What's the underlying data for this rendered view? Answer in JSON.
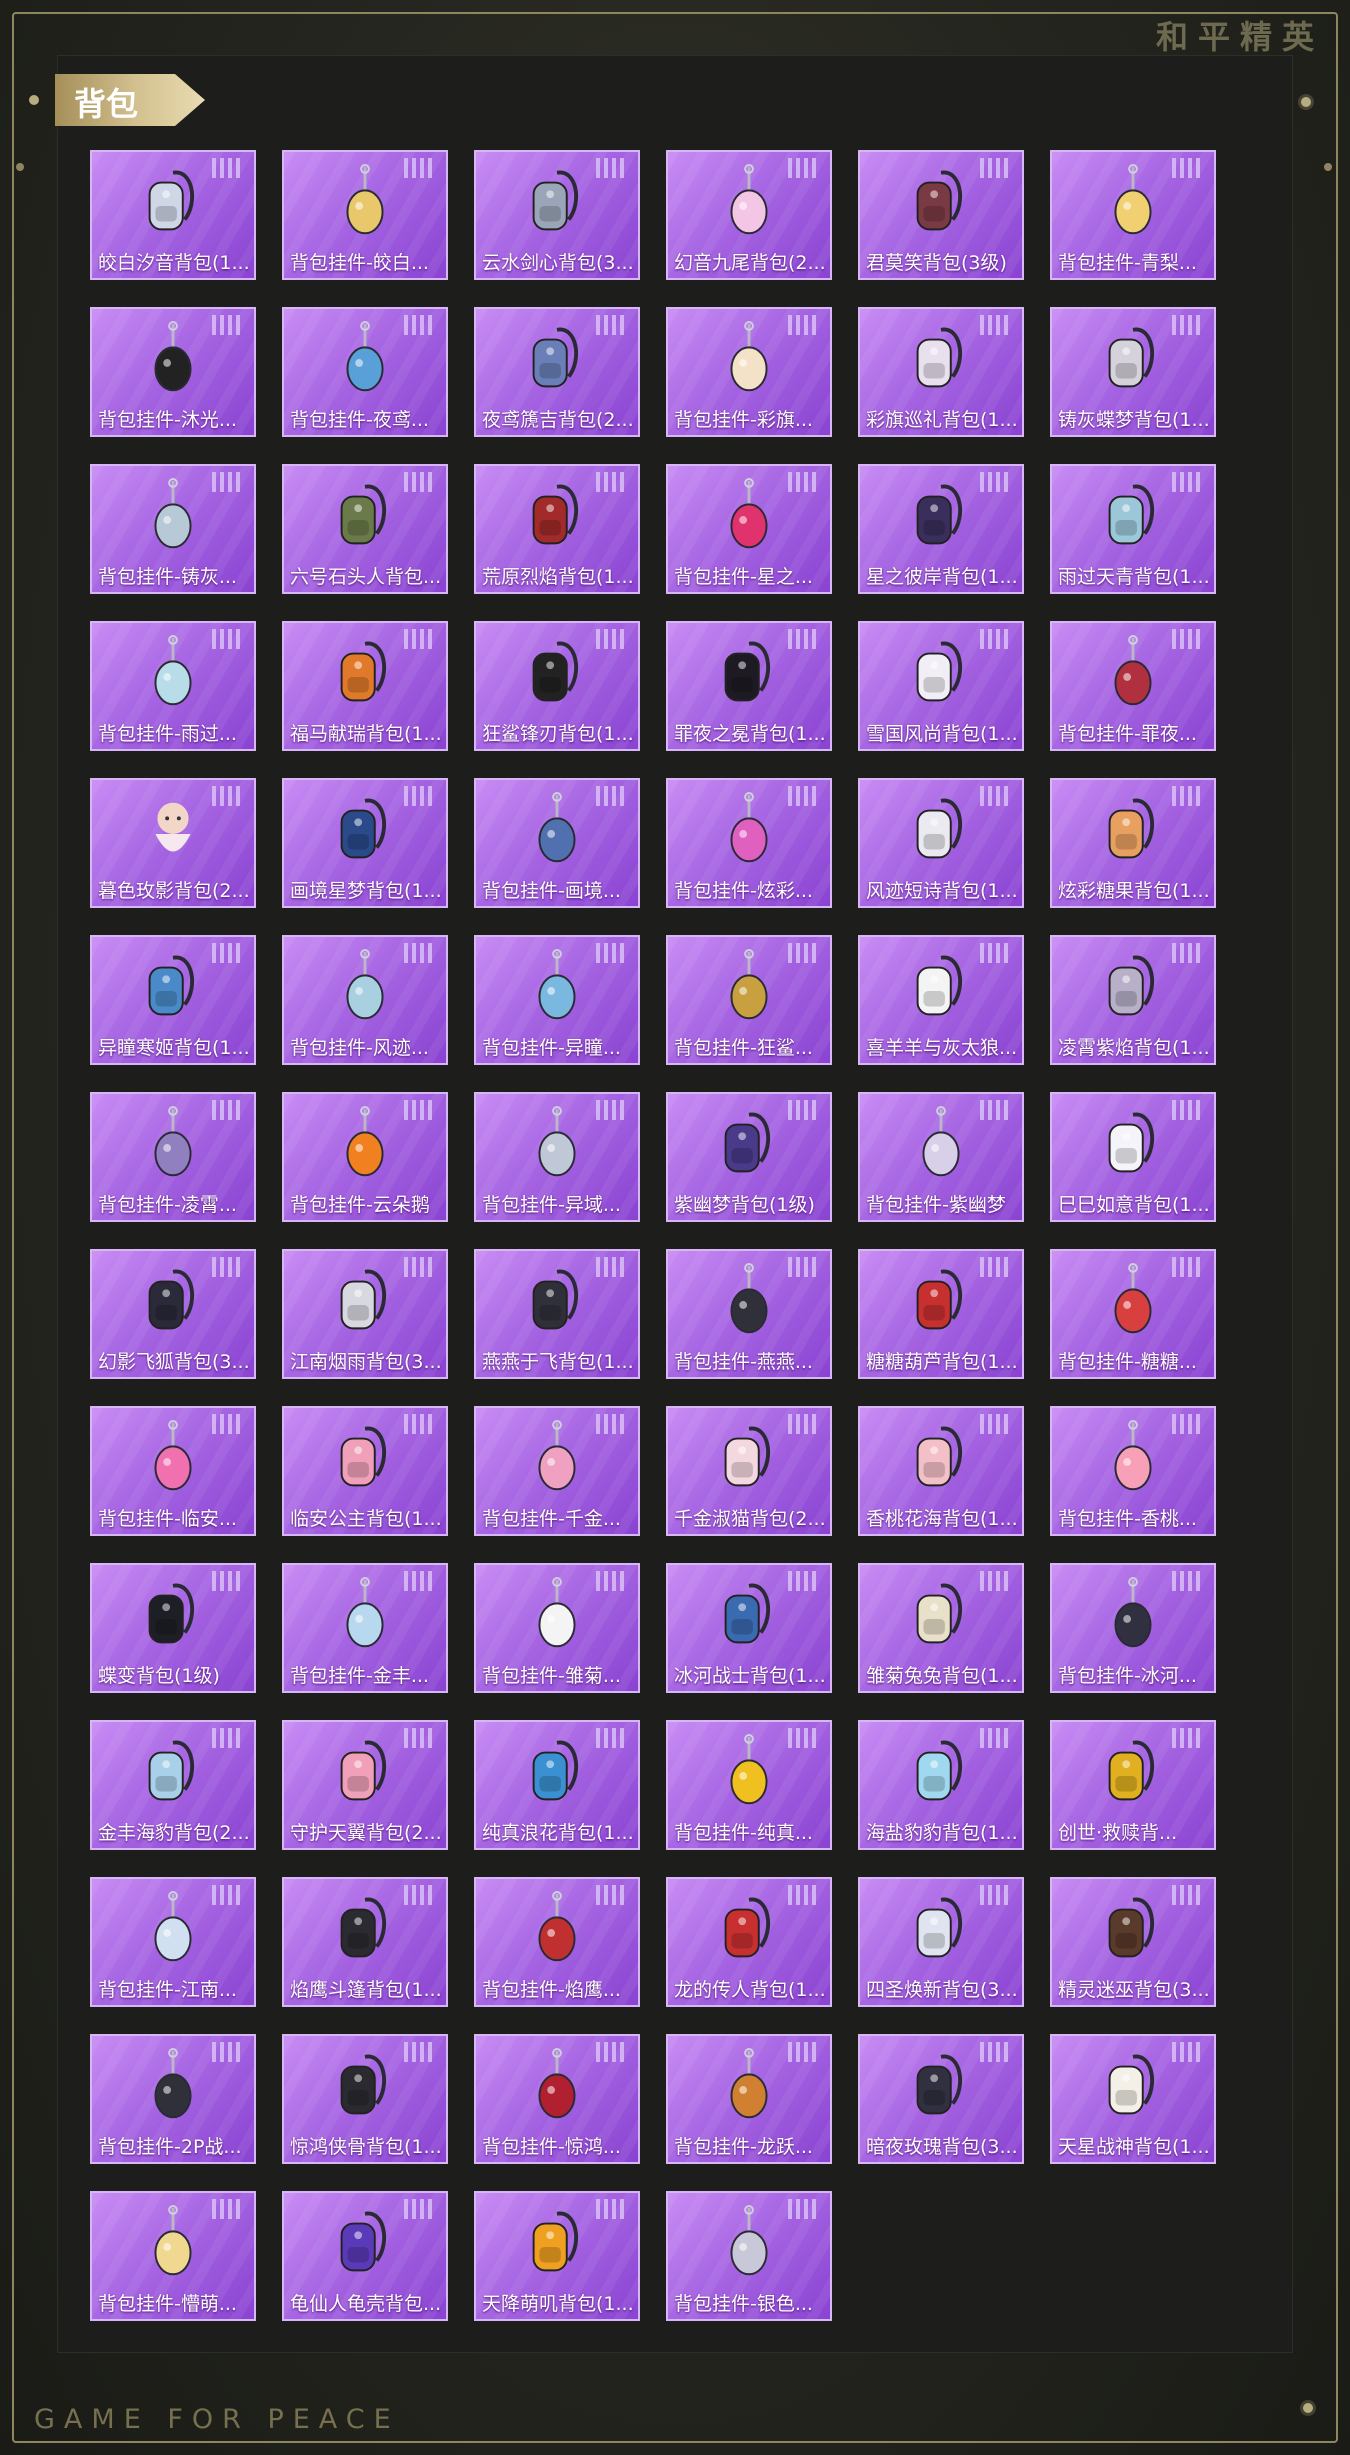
{
  "brand": {
    "title": "和平精英",
    "footer": "GAME FOR PEACE"
  },
  "section": {
    "title": "背包"
  },
  "items": [
    {
      "name": "皎白汐音背包(1...",
      "icon": "backpack-icon",
      "color": "#cfd6e6"
    },
    {
      "name": "背包挂件-皎白...",
      "icon": "pendant-icon",
      "color": "#e8c86a"
    },
    {
      "name": "云水剑心背包(3...",
      "icon": "backpack-icon",
      "color": "#9aa6b8"
    },
    {
      "name": "幻音九尾背包(2...",
      "icon": "fox-pendant-icon",
      "color": "#f3c6e6"
    },
    {
      "name": "君莫笑背包(3级)",
      "icon": "backpack-icon",
      "color": "#7a3a44"
    },
    {
      "name": "背包挂件-青梨...",
      "icon": "pendant-icon",
      "color": "#f0d070"
    },
    {
      "name": "背包挂件-沐光...",
      "icon": "cat-pendant-icon",
      "color": "#222222"
    },
    {
      "name": "背包挂件-夜鸢...",
      "icon": "bird-pendant-icon",
      "color": "#5aa0d8"
    },
    {
      "name": "夜鸢篪吉背包(2...",
      "icon": "backpack-icon",
      "color": "#6a7fb8"
    },
    {
      "name": "背包挂件-彩旗...",
      "icon": "ice-cream-pendant-icon",
      "color": "#f4e2c8"
    },
    {
      "name": "彩旗巡礼背包(1...",
      "icon": "backpack-icon",
      "color": "#e9e0ee"
    },
    {
      "name": "铸灰蝶梦背包(1...",
      "icon": "backpack-icon",
      "color": "#d6d2dc"
    },
    {
      "name": "背包挂件-铸灰...",
      "icon": "pendant-icon",
      "color": "#b7c8d6"
    },
    {
      "name": "六号石头人背包...",
      "icon": "backpack-icon",
      "color": "#6b7a4a"
    },
    {
      "name": "荒原烈焰背包(1...",
      "icon": "backpack-icon",
      "color": "#a22a2a"
    },
    {
      "name": "背包挂件-星之...",
      "icon": "planet-pendant-icon",
      "color": "#e0336e"
    },
    {
      "name": "星之彼岸背包(1...",
      "icon": "backpack-icon",
      "color": "#3a2f5c"
    },
    {
      "name": "雨过天青背包(1...",
      "icon": "backpack-icon",
      "color": "#9cc7d8"
    },
    {
      "name": "背包挂件-雨过...",
      "icon": "pendant-icon",
      "color": "#b8dce8"
    },
    {
      "name": "福马献瑞背包(1...",
      "icon": "backpack-icon",
      "color": "#e07a2a"
    },
    {
      "name": "狂鲨锋刃背包(1...",
      "icon": "backpack-icon",
      "color": "#222222"
    },
    {
      "name": "罪夜之冕背包(1...",
      "icon": "backpack-icon",
      "color": "#1e1a24"
    },
    {
      "name": "雪国风尚背包(1...",
      "icon": "backpack-icon",
      "color": "#f2eef6"
    },
    {
      "name": "背包挂件-罪夜...",
      "icon": "bat-pendant-icon",
      "color": "#b03040"
    },
    {
      "name": "暮色玫影背包(2...",
      "icon": "doll-icon",
      "color": "#f2d6c8"
    },
    {
      "name": "画境星梦背包(1...",
      "icon": "backpack-icon",
      "color": "#2a4a8a"
    },
    {
      "name": "背包挂件-画境...",
      "icon": "pendant-icon",
      "color": "#5070b0"
    },
    {
      "name": "背包挂件-炫彩...",
      "icon": "candy-pendant-icon",
      "color": "#e060c0"
    },
    {
      "name": "风迹短诗背包(1...",
      "icon": "backpack-icon",
      "color": "#eaeaf0"
    },
    {
      "name": "炫彩糖果背包(1...",
      "icon": "backpack-icon",
      "color": "#e8a060"
    },
    {
      "name": "异瞳寒姬背包(1...",
      "icon": "backpack-icon",
      "color": "#4a8ac8"
    },
    {
      "name": "背包挂件-风迹...",
      "icon": "pendant-icon",
      "color": "#a8d0e0"
    },
    {
      "name": "背包挂件-异瞳...",
      "icon": "bell-pendant-icon",
      "color": "#7ab8e0"
    },
    {
      "name": "背包挂件-狂鲨...",
      "icon": "fin-pendant-icon",
      "color": "#c8a040"
    },
    {
      "name": "喜羊羊与灰太狼...",
      "icon": "backpack-icon",
      "color": "#f4f4f4"
    },
    {
      "name": "凌霄紫焰背包(1...",
      "icon": "backpack-icon",
      "color": "#b8b0c8"
    },
    {
      "name": "背包挂件-凌霄...",
      "icon": "pendant-icon",
      "color": "#9080c0"
    },
    {
      "name": "背包挂件-云朵鹅",
      "icon": "goose-pendant-icon",
      "color": "#f08020"
    },
    {
      "name": "背包挂件-异域...",
      "icon": "pendant-icon",
      "color": "#c0c8d8"
    },
    {
      "name": "紫幽梦背包(1级)",
      "icon": "backpack-icon",
      "color": "#4a3a8a"
    },
    {
      "name": "背包挂件-紫幽梦",
      "icon": "pendant-icon",
      "color": "#d8d0e8"
    },
    {
      "name": "巳巳如意背包(1...",
      "icon": "backpack-icon",
      "color": "#f4f4fa"
    },
    {
      "name": "幻影飞狐背包(3...",
      "icon": "backpack-icon",
      "color": "#2a2a3a"
    },
    {
      "name": "江南烟雨背包(3...",
      "icon": "backpack-icon",
      "color": "#d8d8e0"
    },
    {
      "name": "燕燕于飞背包(1...",
      "icon": "backpack-icon",
      "color": "#30303a"
    },
    {
      "name": "背包挂件-燕燕...",
      "icon": "swallow-pendant-icon",
      "color": "#30303a"
    },
    {
      "name": "糖糖葫芦背包(1...",
      "icon": "backpack-icon",
      "color": "#c83030"
    },
    {
      "name": "背包挂件-糖糖...",
      "icon": "pendant-icon",
      "color": "#d84040"
    },
    {
      "name": "背包挂件-临安...",
      "icon": "butterfly-pendant-icon",
      "color": "#f070b0"
    },
    {
      "name": "临安公主背包(1...",
      "icon": "backpack-icon",
      "color": "#f0a0b8"
    },
    {
      "name": "背包挂件-千金...",
      "icon": "pendant-icon",
      "color": "#f0a0c0"
    },
    {
      "name": "千金淑猫背包(2...",
      "icon": "backpack-icon",
      "color": "#f4d8e0"
    },
    {
      "name": "香桃花海背包(1...",
      "icon": "backpack-icon",
      "color": "#f4c0c8"
    },
    {
      "name": "背包挂件-香桃...",
      "icon": "flower-pendant-icon",
      "color": "#f8a0b8"
    },
    {
      "name": "蝶变背包(1级)",
      "icon": "backpack-icon",
      "color": "#1e1e26"
    },
    {
      "name": "背包挂件-金丰...",
      "icon": "pendant-icon",
      "color": "#b8d8f0"
    },
    {
      "name": "背包挂件-雏菊...",
      "icon": "bunny-pendant-icon",
      "color": "#f4f4f4"
    },
    {
      "name": "冰河战士背包(1...",
      "icon": "backpack-icon",
      "color": "#3a6ab0"
    },
    {
      "name": "雏菊兔兔背包(1...",
      "icon": "backpack-icon",
      "color": "#e8e0c8"
    },
    {
      "name": "背包挂件-冰河...",
      "icon": "robot-pendant-icon",
      "color": "#303040"
    },
    {
      "name": "金丰海豹背包(2...",
      "icon": "backpack-icon",
      "color": "#a8d0e8"
    },
    {
      "name": "守护天翼背包(2...",
      "icon": "backpack-icon",
      "color": "#f0a0b8"
    },
    {
      "name": "纯真浪花背包(1...",
      "icon": "backpack-icon",
      "color": "#3a90d0"
    },
    {
      "name": "背包挂件-纯真...",
      "icon": "pendant-icon",
      "color": "#f0c020"
    },
    {
      "name": "海盐豹豹背包(1...",
      "icon": "backpack-icon",
      "color": "#a0d8f0"
    },
    {
      "name": "创世·救赎背...",
      "icon": "backpack-icon",
      "color": "#e0b020"
    },
    {
      "name": "背包挂件-江南...",
      "icon": "pendant-icon",
      "color": "#d0e0f0"
    },
    {
      "name": "焰鹰斗篷背包(1...",
      "icon": "backpack-icon",
      "color": "#2a2a30"
    },
    {
      "name": "背包挂件-焰鹰...",
      "icon": "pendant-icon",
      "color": "#c03030"
    },
    {
      "name": "龙的传人背包(1...",
      "icon": "backpack-icon",
      "color": "#c83030"
    },
    {
      "name": "四圣焕新背包(3...",
      "icon": "backpack-icon",
      "color": "#e0e4f0"
    },
    {
      "name": "精灵迷巫背包(3...",
      "icon": "backpack-icon",
      "color": "#5a3a2a"
    },
    {
      "name": "背包挂件-2P战...",
      "icon": "blade-pendant-icon",
      "color": "#30303a"
    },
    {
      "name": "惊鸿侠骨背包(1...",
      "icon": "backpack-icon",
      "color": "#2a2a30"
    },
    {
      "name": "背包挂件-惊鸿...",
      "icon": "pendant-icon",
      "color": "#b02030"
    },
    {
      "name": "背包挂件-龙跃...",
      "icon": "lion-pendant-icon",
      "color": "#d08030"
    },
    {
      "name": "暗夜玫瑰背包(3...",
      "icon": "backpack-icon",
      "color": "#303040"
    },
    {
      "name": "天星战神背包(1...",
      "icon": "backpack-icon",
      "color": "#f4f0e8"
    },
    {
      "name": "背包挂件-懵萌...",
      "icon": "pendant-icon",
      "color": "#f0d890"
    },
    {
      "name": "龟仙人龟壳背包...",
      "icon": "backpack-icon",
      "color": "#5a3ab8"
    },
    {
      "name": "天降萌叽背包(1...",
      "icon": "backpack-icon",
      "color": "#f0a020"
    },
    {
      "name": "背包挂件-银色...",
      "icon": "pendant-icon",
      "color": "#c8c8d8"
    }
  ]
}
